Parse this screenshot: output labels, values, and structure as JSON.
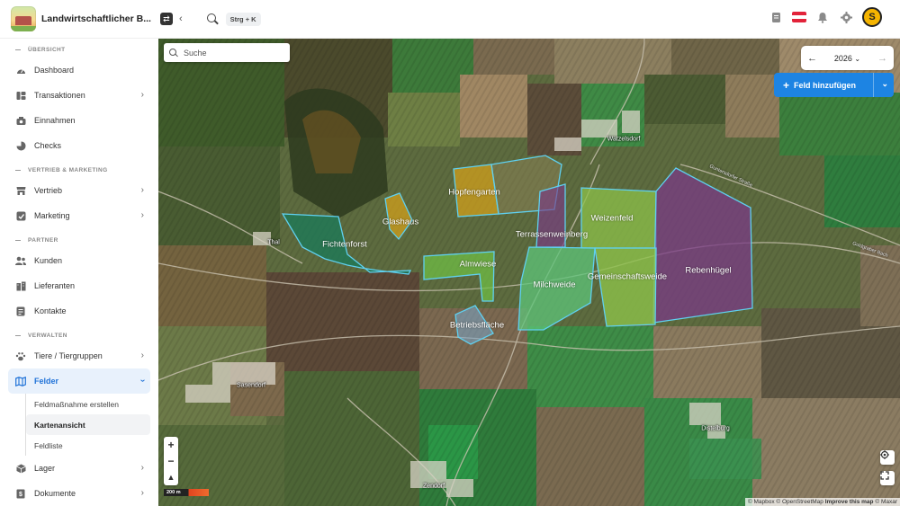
{
  "app": {
    "title": "Landwirtschaftlicher B...",
    "shortcut": "Strg + K",
    "avatar_initial": "S"
  },
  "sidebar": {
    "sections": [
      {
        "label": "ÜBERSICHT"
      },
      {
        "label": "VERTRIEB & MARKETING"
      },
      {
        "label": "PARTNER"
      },
      {
        "label": "VERWALTEN"
      }
    ],
    "items": [
      {
        "label": "Dashboard",
        "icon": "dashboard-icon"
      },
      {
        "label": "Transaktionen",
        "icon": "transactions-icon"
      },
      {
        "label": "Einnahmen",
        "icon": "income-icon"
      },
      {
        "label": "Checks",
        "icon": "checks-icon"
      },
      {
        "label": "Vertrieb",
        "icon": "sales-icon"
      },
      {
        "label": "Marketing",
        "icon": "marketing-icon"
      },
      {
        "label": "Kunden",
        "icon": "customers-icon"
      },
      {
        "label": "Lieferanten",
        "icon": "suppliers-icon"
      },
      {
        "label": "Kontakte",
        "icon": "contacts-icon"
      },
      {
        "label": "Tiere / Tiergruppen",
        "icon": "paw-icon"
      },
      {
        "label": "Felder",
        "icon": "map-icon"
      },
      {
        "label": "Lager",
        "icon": "box-icon"
      },
      {
        "label": "Dokumente",
        "icon": "document-icon"
      }
    ],
    "subitems": [
      {
        "label": "Feldmaßnahme erstellen"
      },
      {
        "label": "Kartenansicht"
      },
      {
        "label": "Feldliste"
      }
    ]
  },
  "map": {
    "search_placeholder": "Suche",
    "year": "2026",
    "add_field_label": "Feld hinzufügen",
    "scale_label": "200 m",
    "attribution": {
      "mapbox": "© Mapbox",
      "osm": "© OpenStreetMap",
      "improve": "Improve this map",
      "maxar": "© Maxar"
    },
    "fields": [
      {
        "name": "Hopfengarten",
        "color": "#d9a21a"
      },
      {
        "name": "Glashaus",
        "color": "#d9a21a"
      },
      {
        "name": "Fichtenforst",
        "color": "#1a7a5a"
      },
      {
        "name": "Terrassenweinberg",
        "color": "#7a3a86"
      },
      {
        "name": "Weizenfeld",
        "color": "#8cc04a"
      },
      {
        "name": "Rebenhügel",
        "color": "#7a3a86"
      },
      {
        "name": "Almwiese",
        "color": "#6fbf45"
      },
      {
        "name": "Gemeinschaftsweide",
        "color": "#8cc04a"
      },
      {
        "name": "Milchweide",
        "color": "#5ec47a"
      },
      {
        "name": "Betriebsfläche",
        "color": "#7aa6c8"
      }
    ],
    "places": [
      "Watzelsdorf",
      "Thal",
      "Sasendorf",
      "Distelburg",
      "Zendorf"
    ],
    "roads": [
      "Guntersdorfer Straße",
      "Goldgraber Bach"
    ]
  }
}
